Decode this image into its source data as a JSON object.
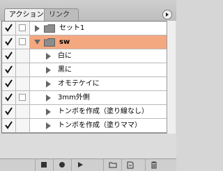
{
  "tabs": [
    {
      "label": "アクション",
      "active": true
    },
    {
      "label": "リンク",
      "active": false
    }
  ],
  "rows": [
    {
      "label": "セット1",
      "type": "set",
      "checked": true,
      "dialog": false,
      "expanded": false,
      "selected": false
    },
    {
      "label": "sw",
      "type": "action",
      "checked": true,
      "dialog": false,
      "expanded": true,
      "selected": true
    },
    {
      "label": "白に",
      "type": "step",
      "checked": true,
      "dialog": false,
      "expanded": false,
      "selected": false
    },
    {
      "label": "黒に",
      "type": "step",
      "checked": true,
      "dialog": false,
      "expanded": false,
      "selected": false
    },
    {
      "label": "オモテケイに",
      "type": "step",
      "checked": true,
      "dialog": false,
      "expanded": false,
      "selected": false
    },
    {
      "label": "3mm外側",
      "type": "step",
      "checked": true,
      "dialog": false,
      "expanded": false,
      "selected": false
    },
    {
      "label": "トンボを作成（塗り線なし）",
      "type": "step",
      "checked": true,
      "dialog": false,
      "expanded": false,
      "selected": false
    },
    {
      "label": "トンボを作成（塗りママ）",
      "type": "step",
      "checked": true,
      "dialog": false,
      "expanded": false,
      "selected": false
    }
  ],
  "toolbar": [
    "stop-icon",
    "record-icon",
    "play-icon",
    "new-set-icon",
    "new-action-icon",
    "trash-icon"
  ],
  "colors": {
    "selected_row": "#f4a880",
    "panel": "#dcdcdc"
  }
}
